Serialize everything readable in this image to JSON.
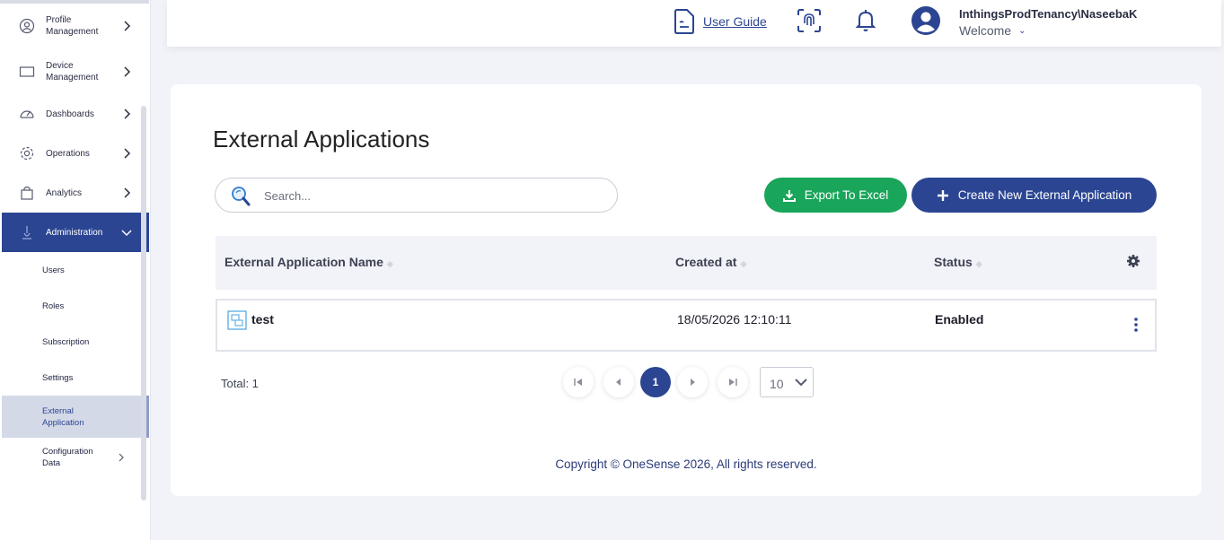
{
  "sidebar": {
    "nav": [
      {
        "label": "Profile\nManagement",
        "icon": "user-circle-icon"
      },
      {
        "label": "Device\nManagement",
        "icon": "laptop-icon"
      },
      {
        "label": "Dashboards",
        "icon": "gauge-icon"
      },
      {
        "label": "Operations",
        "icon": "gear-icon"
      },
      {
        "label": "Analytics",
        "icon": "bag-icon"
      },
      {
        "label": "Administration",
        "icon": "admin-icon"
      }
    ],
    "sub": [
      {
        "label": "Users"
      },
      {
        "label": "Roles"
      },
      {
        "label": "Subscription"
      },
      {
        "label": "Settings"
      },
      {
        "label": "External\nApplication"
      },
      {
        "label": "Configuration\nData"
      }
    ]
  },
  "header": {
    "user_guide": "User Guide",
    "user_name": "InthingsProdTenancy\\NaseebaK",
    "welcome": "Welcome"
  },
  "page": {
    "title": "External Applications",
    "search_placeholder": "Search...",
    "export_label": "Export To Excel",
    "create_label": "Create New External Application"
  },
  "table": {
    "columns": [
      "External Application Name",
      "Created at",
      "Status"
    ],
    "rows": [
      {
        "name": "test",
        "created_at": "18/05/2026 12:10:11",
        "status": "Enabled"
      }
    ]
  },
  "pagination": {
    "total": "Total: 1",
    "current_page": "1",
    "page_size": "10"
  },
  "footer": {
    "copyright": "Copyright © OneSense 2026, All rights reserved."
  },
  "colors": {
    "primary": "#2b4592",
    "export_green": "#19a55a",
    "background": "#f1f3f9"
  }
}
